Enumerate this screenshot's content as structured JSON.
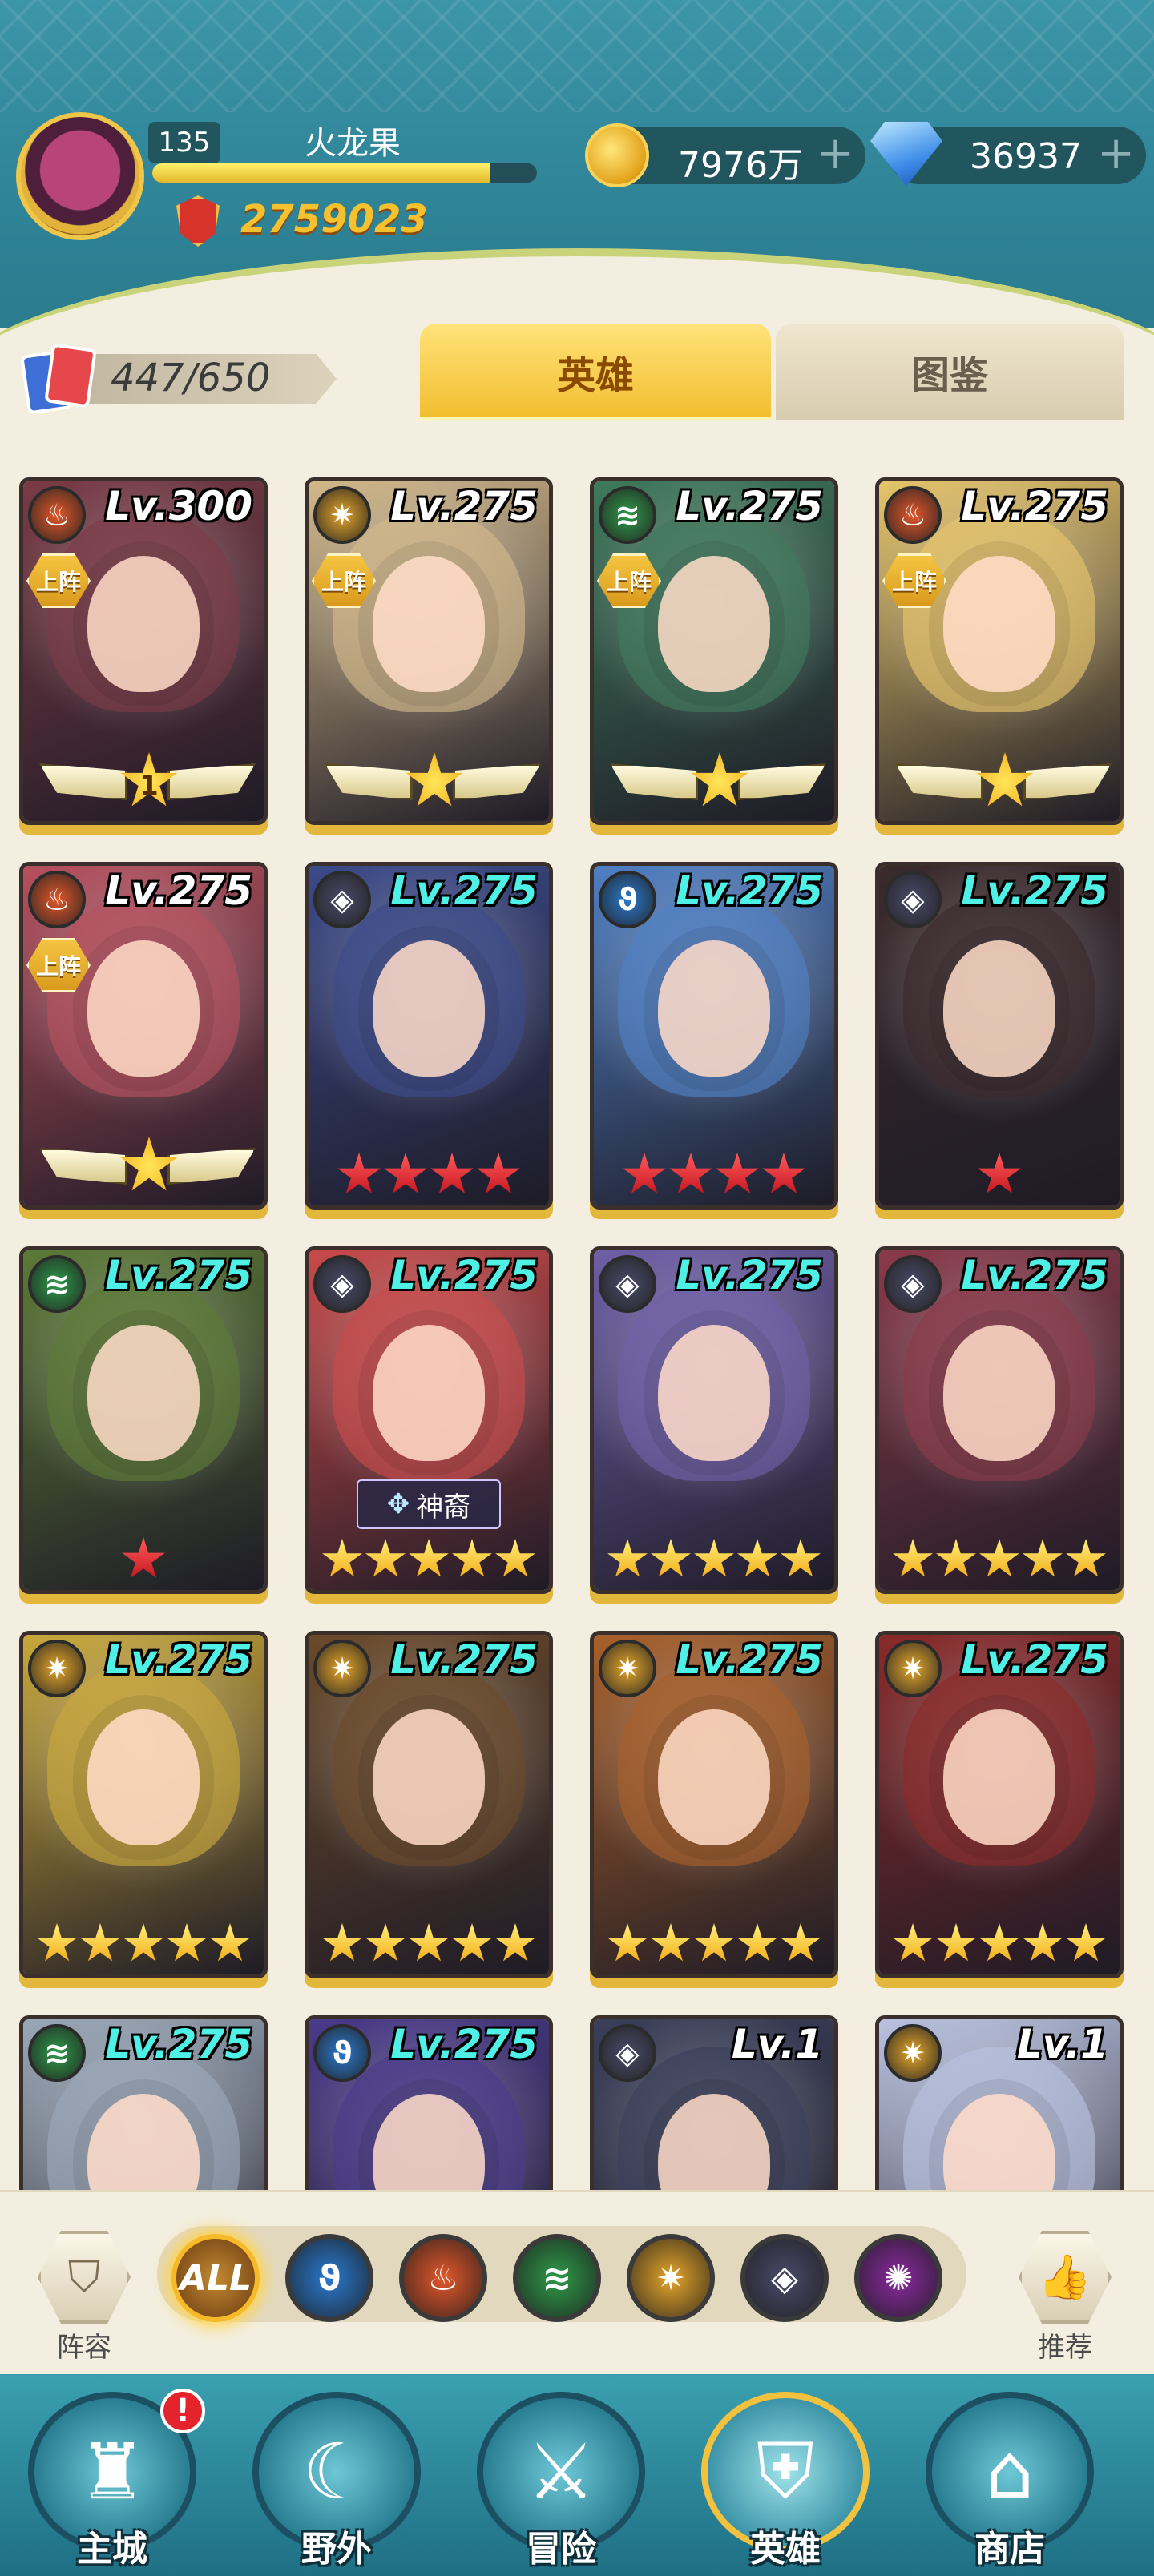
{
  "player": {
    "level": "135",
    "name": "火龙果",
    "xp_fraction": 0.88,
    "power": "2759023"
  },
  "currencies": {
    "gold": "7976万",
    "gems": "36937",
    "add_symbol": "+"
  },
  "hero_count": "447/650",
  "tabs": [
    {
      "label": "英雄",
      "active": true
    },
    {
      "label": "图鉴",
      "active": false
    }
  ],
  "heroes": [
    {
      "level": "Lv.300",
      "faction": "fire",
      "deployed": true,
      "rank_type": "wings",
      "rank_num": "1",
      "level_color": "white",
      "theme": "#7b3b46"
    },
    {
      "level": "Lv.275",
      "faction": "light",
      "deployed": true,
      "rank_type": "wings",
      "rank_num": "",
      "level_color": "white",
      "theme": "#d3b98a"
    },
    {
      "level": "Lv.275",
      "faction": "wind",
      "deployed": true,
      "rank_type": "wings",
      "rank_num": "",
      "level_color": "white",
      "theme": "#3f7a5c"
    },
    {
      "level": "Lv.275",
      "faction": "fire",
      "deployed": true,
      "rank_type": "wings",
      "rank_num": "",
      "level_color": "white",
      "theme": "#e6c56a"
    },
    {
      "level": "Lv.275",
      "faction": "fire",
      "deployed": true,
      "rank_type": "wings",
      "rank_num": "",
      "level_color": "white",
      "theme": "#b7505e"
    },
    {
      "level": "Lv.275",
      "faction": "dark",
      "deployed": false,
      "rank_type": "red",
      "red_stars": 4,
      "level_color": "cyan",
      "theme": "#3b4a8a"
    },
    {
      "level": "Lv.275",
      "faction": "water",
      "deployed": false,
      "rank_type": "red",
      "red_stars": 4,
      "level_color": "cyan",
      "theme": "#4f7fc4"
    },
    {
      "level": "Lv.275",
      "faction": "dark",
      "deployed": false,
      "rank_type": "red",
      "red_stars": 1,
      "level_color": "cyan",
      "theme": "#3a2a2c"
    },
    {
      "level": "Lv.275",
      "faction": "wind",
      "deployed": false,
      "rank_type": "red",
      "red_stars": 1,
      "level_color": "cyan",
      "theme": "#5c7a36"
    },
    {
      "level": "Lv.275",
      "faction": "dark",
      "deployed": false,
      "rank_type": "gold",
      "gold_stars": 5,
      "divine": "神裔",
      "level_color": "cyan",
      "theme": "#c94a4a"
    },
    {
      "level": "Lv.275",
      "faction": "dark",
      "deployed": false,
      "rank_type": "gold",
      "gold_stars": 5,
      "level_color": "cyan",
      "theme": "#6f5fa8"
    },
    {
      "level": "Lv.275",
      "faction": "dark",
      "deployed": false,
      "rank_type": "gold",
      "gold_stars": 5,
      "level_color": "cyan",
      "theme": "#8a3a4a"
    },
    {
      "level": "Lv.275",
      "faction": "light",
      "deployed": false,
      "rank_type": "gold",
      "gold_stars": 5,
      "level_color": "cyan",
      "theme": "#c9a83a"
    },
    {
      "level": "Lv.275",
      "faction": "light",
      "deployed": false,
      "rank_type": "gold",
      "gold_stars": 5,
      "level_color": "cyan",
      "theme": "#6b4a2a"
    },
    {
      "level": "Lv.275",
      "faction": "light",
      "deployed": false,
      "rank_type": "gold",
      "gold_stars": 5,
      "level_color": "cyan",
      "theme": "#a8602a"
    },
    {
      "level": "Lv.275",
      "faction": "light",
      "deployed": false,
      "rank_type": "gold",
      "gold_stars": 5,
      "level_color": "cyan",
      "theme": "#8a2a2a"
    },
    {
      "level": "Lv.275",
      "faction": "wind",
      "deployed": false,
      "rank_type": "none",
      "level_color": "cyan",
      "theme": "#9aa8b8"
    },
    {
      "level": "Lv.275",
      "faction": "water",
      "deployed": false,
      "rank_type": "none",
      "level_color": "cyan",
      "theme": "#4a3a8a"
    },
    {
      "level": "Lv.1",
      "faction": "dark",
      "deployed": false,
      "rank_type": "none",
      "level_color": "white",
      "theme": "#3a3f5a"
    },
    {
      "level": "Lv.1",
      "faction": "light",
      "deployed": false,
      "rank_type": "none",
      "level_color": "white",
      "theme": "#b9c2e0"
    }
  ],
  "deploy_label": "上阵",
  "factions": {
    "fire": {
      "color": "#e2572a",
      "icon": "fire-icon",
      "glyph": "♨"
    },
    "light": {
      "color": "#e6a62a",
      "icon": "light-icon",
      "glyph": "✷"
    },
    "wind": {
      "color": "#2f9a4a",
      "icon": "wind-icon",
      "glyph": "≋"
    },
    "water": {
      "color": "#2a7ad0",
      "icon": "water-icon",
      "glyph": "ϑ"
    },
    "dark": {
      "color": "#4a4a6a",
      "icon": "dark-icon",
      "glyph": "◈"
    },
    "arcane": {
      "color": "#8a2aa0",
      "icon": "arcane-icon",
      "glyph": "✺"
    }
  },
  "filters": [
    {
      "key": "all",
      "label": "ALL",
      "active": true
    },
    {
      "key": "water",
      "label": "",
      "active": false
    },
    {
      "key": "fire",
      "label": "",
      "active": false
    },
    {
      "key": "wind",
      "label": "",
      "active": false
    },
    {
      "key": "light",
      "label": "",
      "active": false
    },
    {
      "key": "dark",
      "label": "",
      "active": false
    },
    {
      "key": "arcane",
      "label": "",
      "active": false
    }
  ],
  "side_buttons": {
    "lineup": {
      "label": "阵容",
      "icon": "shield-icon"
    },
    "recommend": {
      "label": "推荐",
      "icon": "thumbs-up-icon"
    }
  },
  "nav": [
    {
      "label": "主城",
      "icon": "castle-icon",
      "glyph": "♜",
      "active": false,
      "alert": "!"
    },
    {
      "label": "野外",
      "icon": "wilds-portal-icon",
      "glyph": "☾",
      "active": false
    },
    {
      "label": "冒险",
      "icon": "sword-icon",
      "glyph": "⚔",
      "active": false
    },
    {
      "label": "英雄",
      "icon": "helmet-icon",
      "glyph": "⛨",
      "active": true
    },
    {
      "label": "商店",
      "icon": "shop-icon",
      "glyph": "⌂",
      "active": false
    }
  ]
}
